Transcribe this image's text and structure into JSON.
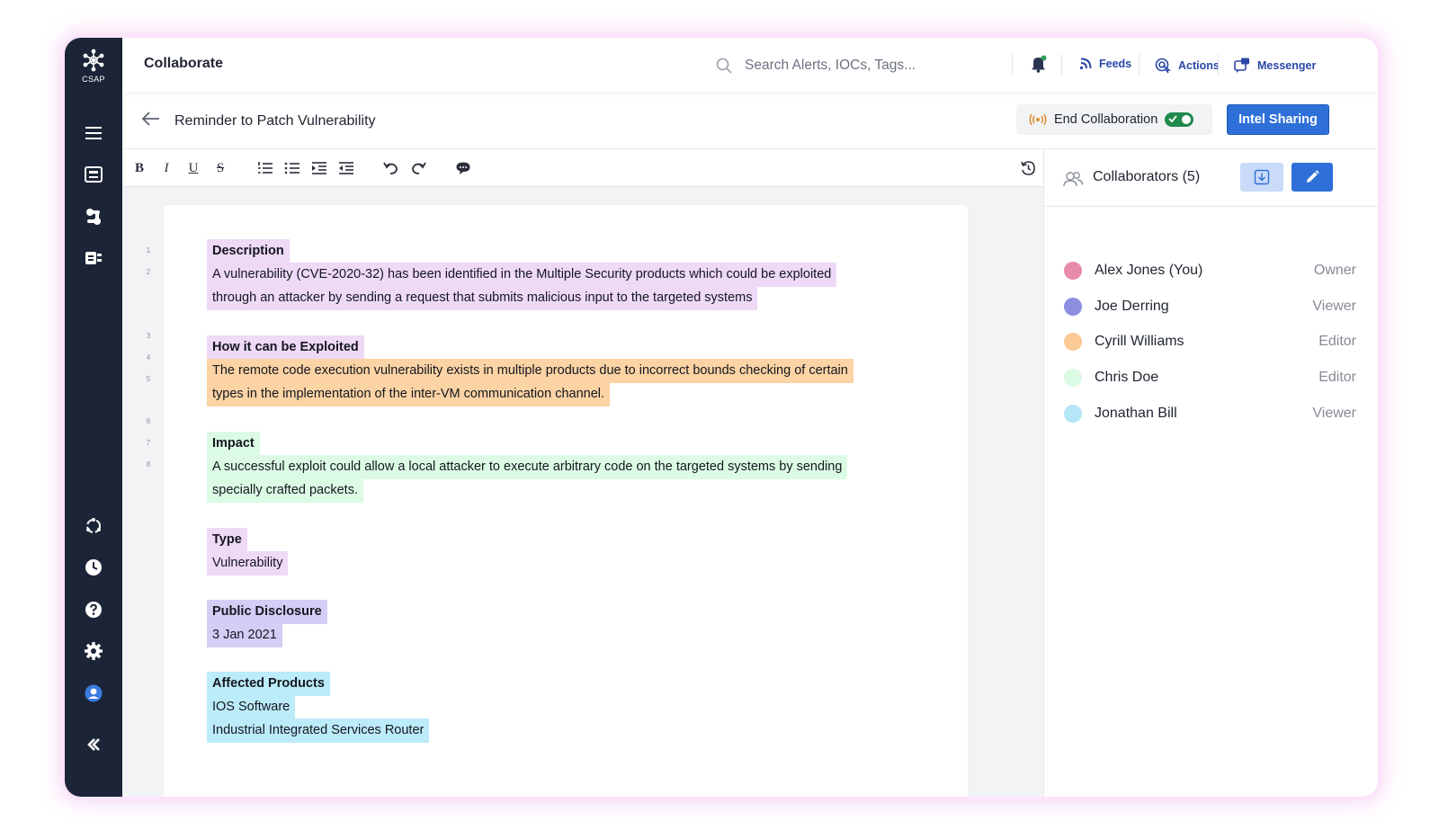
{
  "brand": {
    "label": "CSAP"
  },
  "topbar": {
    "title": "Collaborate",
    "search_placeholder": "Search Alerts, IOCs, Tags...",
    "links": [
      {
        "label": "Feeds",
        "icon": "rss-icon"
      },
      {
        "label": "Actions",
        "icon": "actions-icon"
      },
      {
        "label": "Messenger",
        "icon": "messenger-icon"
      }
    ]
  },
  "doc": {
    "title": "Reminder to Patch Vulnerability",
    "end_collab_label": "End Collaboration",
    "intel_button": "Intel Sharing"
  },
  "editor": {
    "line_numbers": [
      "1",
      "2",
      "3",
      "4",
      "5",
      "6",
      "7",
      "8"
    ],
    "sections": [
      {
        "heading": "Description",
        "lines": [
          "A vulnerability (CVE-2020-32) has been identified in the Multiple Security products which could be exploited",
          "through an attacker by sending a request that submits malicious input to the targeted systems"
        ],
        "color": "#eed9f7"
      },
      {
        "heading": "How it can be Exploited",
        "lines": [
          "The remote code execution vulnerability exists in multiple products due to incorrect bounds checking of certain",
          "types in the implementation of the inter-VM communication channel."
        ],
        "color": "#fcd3a4"
      },
      {
        "heading": "Impact",
        "lines": [
          "A successful exploit could allow a local attacker to execute arbitrary code on the targeted systems by sending",
          "specially crafted packets."
        ],
        "color": "#dcfbe5"
      },
      {
        "heading": "Type",
        "lines": [
          "Vulnerability"
        ],
        "color": "#eed9f7"
      },
      {
        "heading": "Public Disclosure",
        "lines": [
          "3 Jan 2021"
        ],
        "color": "#d6cdf7"
      },
      {
        "heading": "Affected Products",
        "lines": [
          "IOS Software",
          "Industrial Integrated Services Router"
        ],
        "color": "#bcebf9"
      }
    ]
  },
  "collaborators": {
    "label": "Collaborators (5)",
    "list": [
      {
        "name": "Alex Jones (You)",
        "role": "Owner",
        "color": "#e78ba8"
      },
      {
        "name": "Joe Derring",
        "role": "Viewer",
        "color": "#8d8fe0"
      },
      {
        "name": "Cyrill Williams",
        "role": "Editor",
        "color": "#fbc995"
      },
      {
        "name": "Chris Doe",
        "role": "Editor",
        "color": "#dcfbe5"
      },
      {
        "name": "Jonathan Bill",
        "role": "Viewer",
        "color": "#b5e6f8"
      }
    ]
  }
}
